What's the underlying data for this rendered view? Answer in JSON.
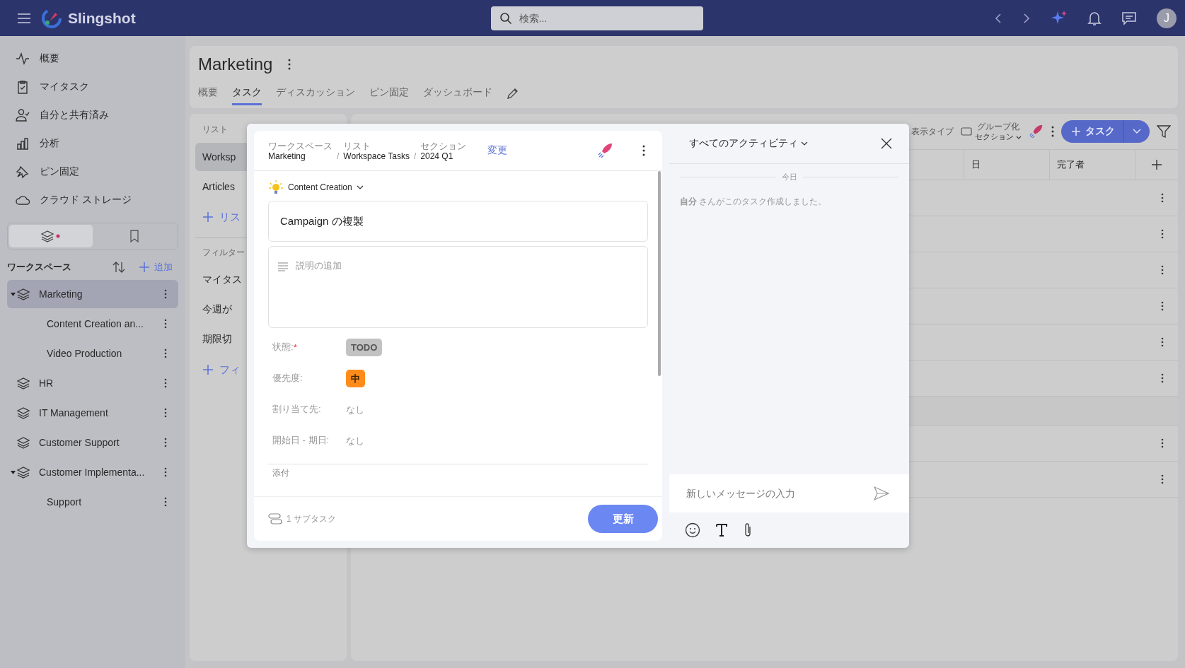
{
  "topbar": {
    "app_name": "Slingshot",
    "search": {
      "placeholder": "検索..."
    },
    "avatar": "J"
  },
  "sidebar": {
    "nav": [
      {
        "label": "概要",
        "kind": "overview"
      },
      {
        "label": "マイタスク",
        "kind": "tasks"
      },
      {
        "label": "自分と共有済み",
        "kind": "shared"
      },
      {
        "label": "分析",
        "kind": "analytics"
      },
      {
        "label": "ピン固定",
        "kind": "pin"
      },
      {
        "label": "クラウド ストレージ",
        "kind": "cloud"
      }
    ],
    "segments": [
      {
        "kind": "workspaces",
        "selected": true,
        "unread": true
      },
      {
        "kind": "bookmarks",
        "selected": false
      }
    ],
    "workspaces": {
      "title": "ワークスペース",
      "add": "追加",
      "items": [
        {
          "label": "Marketing",
          "selected": true,
          "expanded": true,
          "children": [
            {
              "label": "Content Creation an...",
              "selected": false
            },
            {
              "label": "Video Production",
              "selected": false
            }
          ]
        },
        {
          "label": "HR",
          "selected": false,
          "expanded": false
        },
        {
          "label": "IT Management",
          "selected": false,
          "expanded": false
        },
        {
          "label": "Customer Support",
          "selected": false,
          "expanded": false
        },
        {
          "label": "Customer Implementa...",
          "selected": false,
          "expanded": true,
          "children": [
            {
              "label": "Support",
              "selected": false
            }
          ]
        }
      ]
    }
  },
  "page": {
    "title": "Marketing",
    "tabs": [
      {
        "label": "概要",
        "selected": false
      },
      {
        "label": "タスク",
        "selected": true
      },
      {
        "label": "ディスカッション",
        "selected": false
      },
      {
        "label": "ピン固定",
        "selected": false
      },
      {
        "label": "ダッシュボード",
        "selected": false
      }
    ]
  },
  "lists_panel": {
    "title": "リスト",
    "lists": [
      {
        "label": "Worksp",
        "selected": true
      },
      {
        "label": "Articles",
        "selected": false
      }
    ],
    "add_list": "リス",
    "filters_title": "フィルター",
    "filters": [
      {
        "label": "マイタス",
        "selected": false
      },
      {
        "label": "今週が",
        "selected": false
      },
      {
        "label": "期限切",
        "selected": false
      }
    ],
    "add_filter": "フィ"
  },
  "table": {
    "toolbar": {
      "view_type": "表示タイプ",
      "group_by": "グループ化",
      "group_value": "セクション",
      "new_task": "タスク"
    },
    "columns": [
      "日",
      "完了者"
    ],
    "rows": [
      {
        "kind": "task"
      },
      {
        "kind": "task"
      },
      {
        "kind": "task"
      },
      {
        "kind": "task"
      },
      {
        "kind": "task"
      },
      {
        "kind": "task"
      },
      {
        "kind": "section"
      },
      {
        "kind": "task"
      },
      {
        "kind": "task"
      }
    ]
  },
  "task_dialog": {
    "breadcrumb": [
      {
        "caption": "ワークスペース",
        "value": "Marketing"
      },
      {
        "caption": "リスト",
        "value": "Workspace Tasks"
      },
      {
        "caption": "セクション",
        "value": "2024 Q1"
      }
    ],
    "breadcrumb_separator": "/",
    "change_link": "変更",
    "category": "Content Creation",
    "title": "Campaign の複製",
    "description": {
      "placeholder": "説明の追加"
    },
    "fields": [
      {
        "label": "状態:",
        "required_mark": "*",
        "kind": "status",
        "value": "TODO",
        "color": "#c2c2c2"
      },
      {
        "label": "優先度:",
        "kind": "priority",
        "value": "中",
        "color": "#ff8c1a"
      },
      {
        "label": "割り当て先:",
        "kind": "text",
        "value": "なし"
      },
      {
        "label": "開始日 - 期日:",
        "kind": "text",
        "value": "なし"
      }
    ],
    "attachments_label": "添付",
    "subtasks": "1 サブタスク",
    "update_button": "更新"
  },
  "activity": {
    "filter": "すべてのアクティビティ",
    "day": "今日",
    "entries": [
      "**自分** さんがこのタスク作成しました。"
    ],
    "message": {
      "placeholder": "新しいメッセージの入力"
    }
  }
}
